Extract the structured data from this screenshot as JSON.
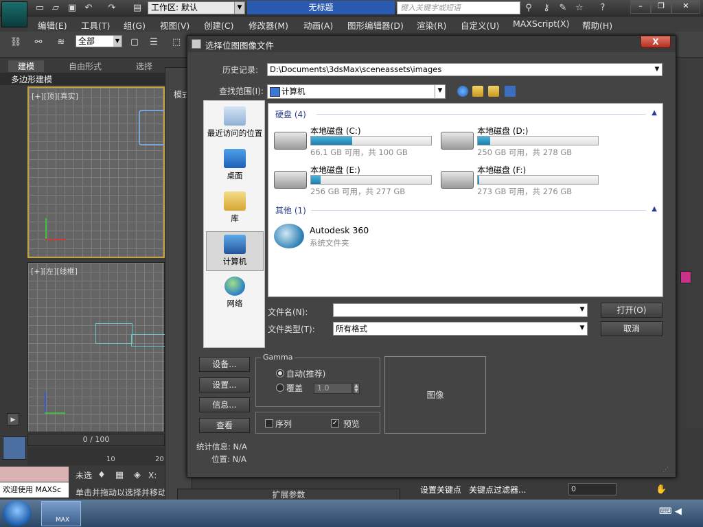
{
  "app": {
    "workspace_label": "工作区: 默认",
    "doc_title": "无标题",
    "search_placeholder": "键入关键字或短语",
    "menus": [
      "编辑(E)",
      "工具(T)",
      "组(G)",
      "视图(V)",
      "创建(C)",
      "修改器(M)",
      "动画(A)",
      "图形编辑器(D)",
      "渲染(R)",
      "自定义(U)",
      "MAXScript(X)",
      "帮助(H)"
    ],
    "selection_filter": "全部",
    "ribbon_tabs": [
      "建模",
      "自由形式",
      "选择"
    ],
    "ribbon_label": "多边形建模",
    "viewport_top_label": "[+][顶][真实]",
    "viewport_left_label": "[+][左][线框]",
    "timeline": "0 / 100",
    "track_ticks": [
      "10",
      "20"
    ],
    "not_selected": "未选",
    "welcome": "欢迎使用 MAXSc",
    "status_hint": "单击并拖动以选择并移动",
    "x_label": "X:",
    "material_tab": "模式",
    "rollout_label": "扩展参数",
    "set_key": "设置关键点",
    "key_filter": "关键点过滤器...",
    "frame_value": "0",
    "taskbar_app": "MAX"
  },
  "dialog": {
    "title": "选择位图图像文件",
    "close_label": "X",
    "history_label": "历史记录:",
    "history_value": "D:\\Documents\\3dsMax\\sceneassets\\images",
    "lookin_label": "查找范围(I):",
    "lookin_value": "计算机",
    "places": [
      "最近访问的位置",
      "桌面",
      "库",
      "计算机",
      "网络"
    ],
    "groups": {
      "hdd": "硬盘 (4)",
      "other": "其他 (1)"
    },
    "drives": [
      {
        "name": "本地磁盘 (C:)",
        "size": "66.1 GB 可用，共 100 GB",
        "used": 0.34
      },
      {
        "name": "本地磁盘 (D:)",
        "size": "250 GB 可用，共 278 GB",
        "used": 0.1
      },
      {
        "name": "本地磁盘 (E:)",
        "size": "256 GB 可用，共 277 GB",
        "used": 0.08
      },
      {
        "name": "本地磁盘 (F:)",
        "size": "273 GB 可用，共 276 GB",
        "used": 0.01
      }
    ],
    "other_item": {
      "name": "Autodesk 360",
      "type": "系统文件夹"
    },
    "filename_label": "文件名(N):",
    "filename_value": "",
    "filetype_label": "文件类型(T):",
    "filetype_value": "所有格式",
    "open_label": "打开(O)",
    "cancel_label": "取消",
    "setup_label": "设备...",
    "settings_label": "设置...",
    "info_label": "信息...",
    "view_label": "查看",
    "gamma_title": "Gamma",
    "gamma_auto": "自动(推荐)",
    "gamma_override": "覆盖",
    "gamma_value": "1.0",
    "sequence_label": "序列",
    "preview_label": "预览",
    "image_label": "图像",
    "stats_label": "统计信息: N/A",
    "location_label": "位置: N/A"
  }
}
